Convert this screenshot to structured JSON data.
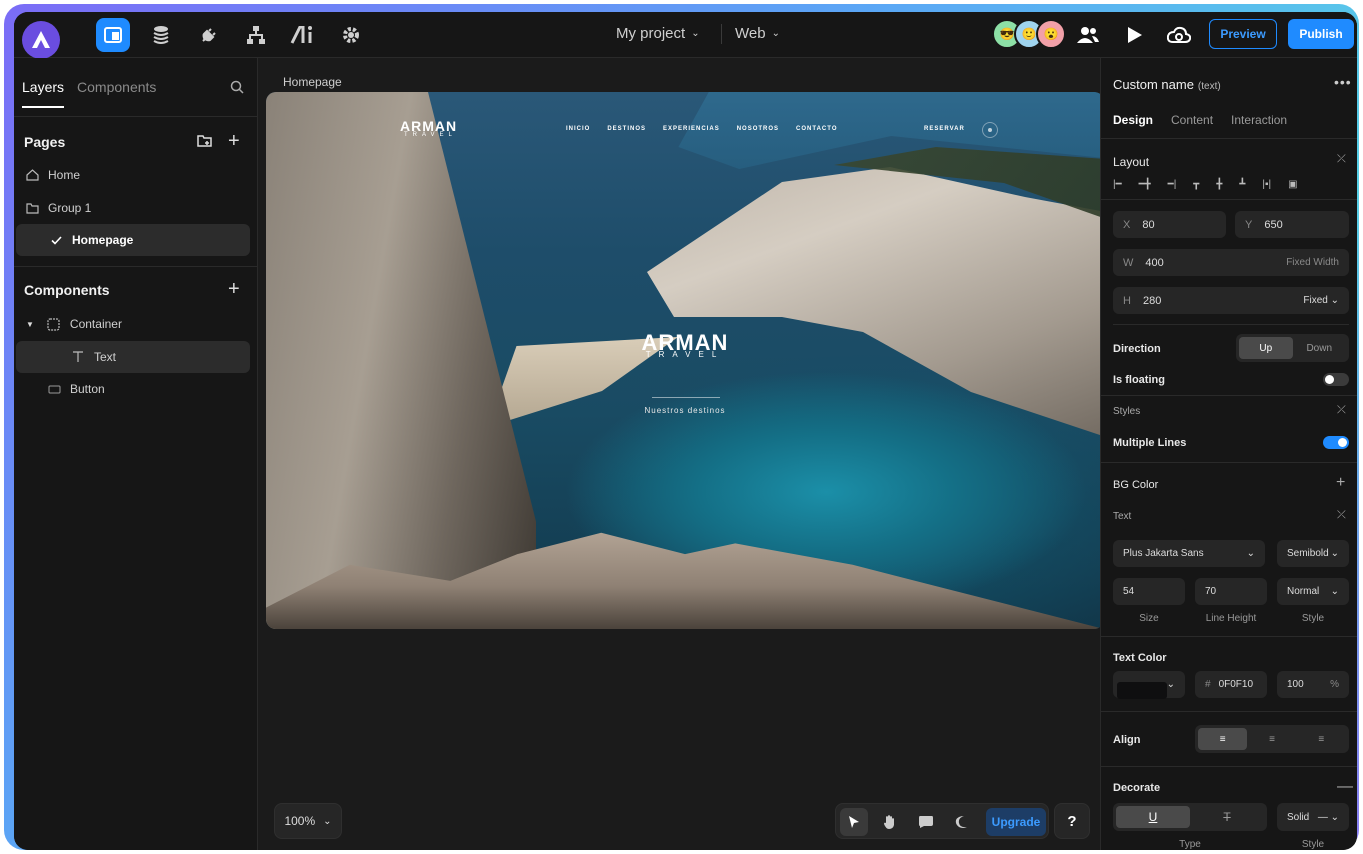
{
  "topbar": {
    "project": "My project",
    "platform": "Web",
    "preview": "Preview",
    "publish": "Publish",
    "avatars": [
      "😎",
      "🙂",
      "😮"
    ]
  },
  "left": {
    "tabs": [
      "Layers",
      "Components"
    ],
    "pages_title": "Pages",
    "pages": [
      "Home",
      "Group 1",
      "Homepage"
    ],
    "components_title": "Components",
    "components": [
      "Container",
      "Text",
      "Button"
    ]
  },
  "canvas": {
    "label": "Homepage",
    "site_logo": "ARMAN",
    "site_logo_sub": "TRAVEL",
    "nav": [
      "INICIO",
      "DESTINOS",
      "EXPERIENCIAS",
      "NOSOTROS",
      "CONTACTO"
    ],
    "reserve": "RESERVAR",
    "hero_title": "ARMAN",
    "hero_sub": "TRAVEL",
    "hero_cta": "Nuestros destinos",
    "zoom": "100%",
    "upgrade": "Upgrade",
    "help": "?"
  },
  "right": {
    "header": "Custom name",
    "header_type": "(text)",
    "tabs": [
      "Design",
      "Content",
      "Interaction"
    ],
    "layout": "Layout",
    "x_key": "X",
    "x": "80",
    "y_key": "Y",
    "y": "650",
    "w_key": "W",
    "w": "400",
    "w_mode": "Fixed Width",
    "h_key": "H",
    "h": "280",
    "h_mode": "Fixed",
    "direction": "Direction",
    "dir_up": "Up",
    "dir_down": "Down",
    "floating": "Is floating",
    "styles": "Styles",
    "multiple_lines": "Multiple Lines",
    "bg_color": "BG Color",
    "text": "Text",
    "font": "Plus Jakarta Sans",
    "weight": "Semibold",
    "size": "54",
    "line_height": "70",
    "style": "Normal",
    "cap_size": "Size",
    "cap_lh": "Line Height",
    "cap_style": "Style",
    "text_color": "Text Color",
    "hash": "#",
    "hex": "0F0F10",
    "opacity": "100",
    "pct": "%",
    "align": "Align",
    "decorate": "Decorate",
    "deco_style": "Solid",
    "cap_type": "Type",
    "cap_style2": "Style"
  },
  "colors": {
    "accent": "#1f8bff",
    "bg": "#161616",
    "text_color": "#0F0F10"
  }
}
